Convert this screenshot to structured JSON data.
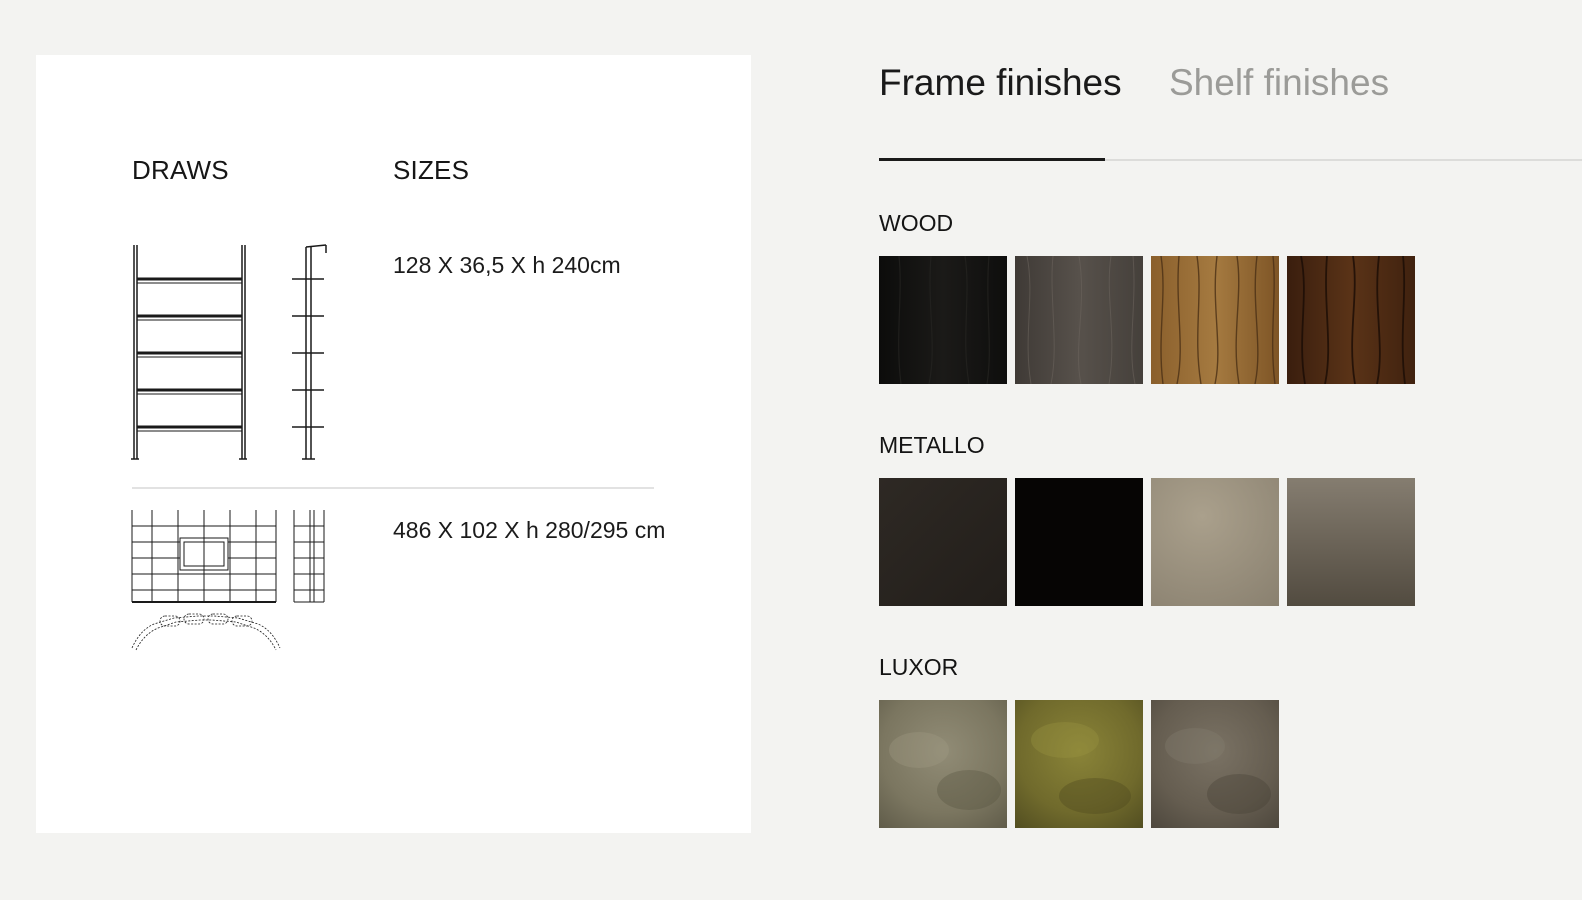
{
  "card": {
    "draws_heading": "DRAWS",
    "sizes_heading": "SIZES",
    "rows": [
      {
        "size": "128 X 36,5 X h 240cm"
      },
      {
        "size": "486 X 102 X h 280/295 cm"
      }
    ]
  },
  "tabs": {
    "frame": "Frame finishes",
    "shelf": "Shelf finishes",
    "active": "frame"
  },
  "groups": {
    "wood": {
      "label": "WOOD"
    },
    "metallo": {
      "label": "METALLO"
    },
    "luxor": {
      "label": "LUXOR"
    }
  },
  "colors": {
    "page_bg": "#f3f3f1",
    "card_bg": "#ffffff",
    "text": "#161616",
    "inactive_tab": "#9b9b98"
  }
}
